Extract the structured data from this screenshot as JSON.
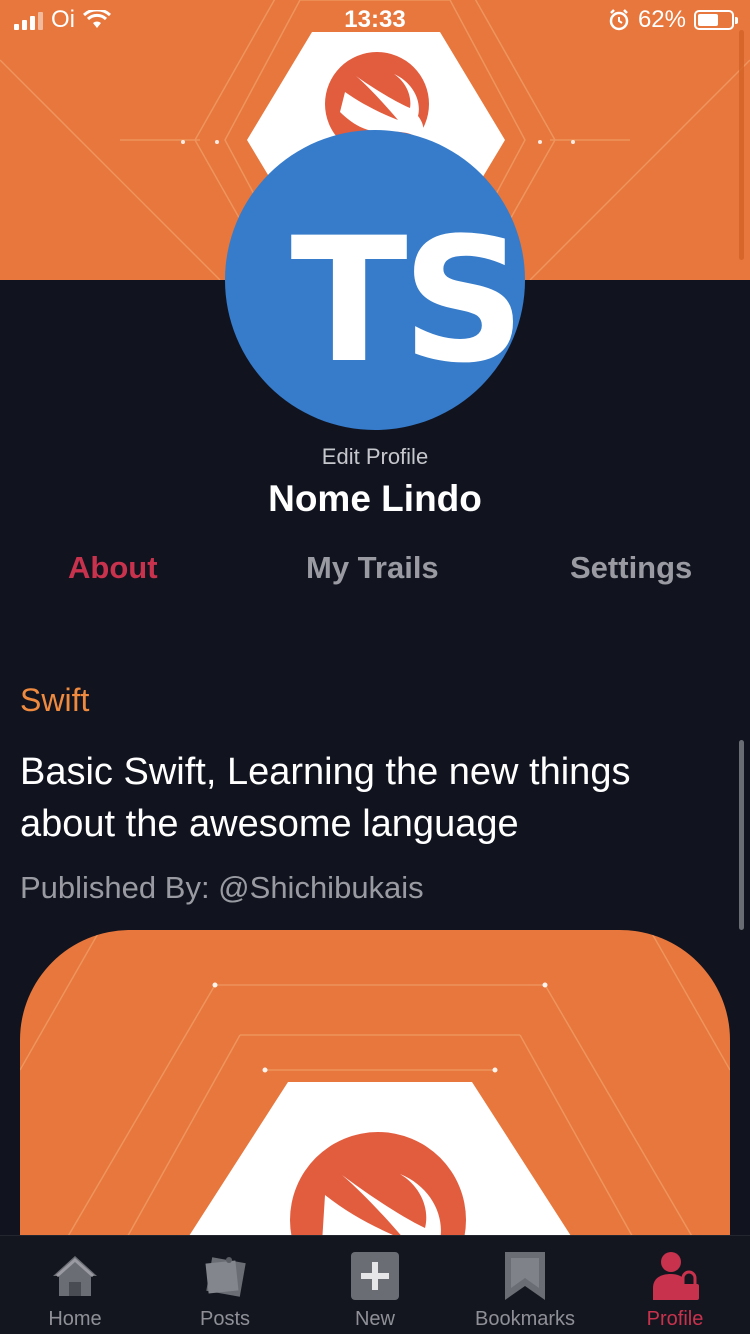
{
  "status_bar": {
    "carrier": "Oi",
    "time": "13:33",
    "battery_percent": "62%",
    "battery_level": 0.62,
    "icons": [
      "signal-icon",
      "wifi-icon",
      "alarm-icon",
      "battery-icon"
    ]
  },
  "profile": {
    "initials": "TS",
    "edit_label": "Edit Profile",
    "name": "Nome Lindo",
    "avatar_color": "#367ccb",
    "banner_color": "#e7773c"
  },
  "tabs": [
    {
      "label": "About",
      "active": true
    },
    {
      "label": "My Trails",
      "active": false
    },
    {
      "label": "Settings",
      "active": false
    }
  ],
  "post": {
    "category": "Swift",
    "title": "Basic Swift, Learning the new things about the awesome language",
    "published_by": "Published By: @Shichibukais",
    "image_icon": "swift-logo-icon"
  },
  "tabbar": [
    {
      "label": "Home",
      "icon": "home-icon",
      "active": false
    },
    {
      "label": "Posts",
      "icon": "posts-icon",
      "active": false
    },
    {
      "label": "New",
      "icon": "plus-icon",
      "active": false
    },
    {
      "label": "Bookmarks",
      "icon": "bookmark-icon",
      "active": false
    },
    {
      "label": "Profile",
      "icon": "profile-lock-icon",
      "active": true
    }
  ],
  "colors": {
    "background": "#11141f",
    "accent": "#c8324d",
    "category": "#ef8a3f",
    "muted": "#9a9ba2"
  }
}
